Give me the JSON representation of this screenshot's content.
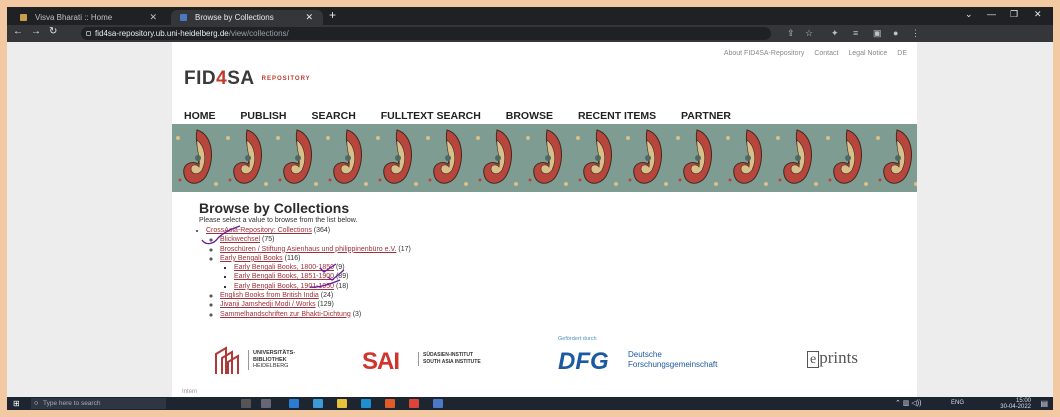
{
  "browser": {
    "tabs": [
      {
        "label": "Visva Bharati :: Home",
        "active": false
      },
      {
        "label": "Browse by Collections",
        "active": true
      }
    ],
    "url_host": "fid4sa-repository.ub.uni-heidelberg.de",
    "url_path": "/view/collections/"
  },
  "site": {
    "top_links": [
      "About FID4SA-Repository",
      "Contact",
      "Legal Notice",
      "DE"
    ],
    "logo_fid": "FID",
    "logo_4": "4",
    "logo_sa": "SA",
    "logo_repository": "REPOSITORY",
    "nav": [
      "HOME",
      "PUBLISH",
      "SEARCH",
      "FULLTEXT SEARCH",
      "BROWSE",
      "RECENT ITEMS",
      "PARTNER"
    ]
  },
  "content": {
    "heading": "Browse by Collections",
    "intro": "Please select a value to browse from the list below.",
    "root": {
      "label": "CrossAsia-Repository: Collections",
      "count": "(364)"
    },
    "items": [
      {
        "label": "Blickwechsel",
        "count": "(75)"
      },
      {
        "label": "Broschüren / Stiftung Asienhaus und philippinenbüro e.V.",
        "count": "(17)"
      },
      {
        "label": "Early Bengali Books",
        "count": "(116)"
      },
      {
        "label": "English Books from British India",
        "count": "(24)"
      },
      {
        "label": "Jivanji Jamshedji Modi / Works",
        "count": "(129)"
      },
      {
        "label": "Sammelhandschriften zur Bhakti-Dichtung",
        "count": "(3)"
      }
    ],
    "subitems": [
      {
        "label": "Early Bengali Books, 1800-1850",
        "count": "(9)"
      },
      {
        "label": "Early Bengali Books, 1851-1900",
        "count": "(89)"
      },
      {
        "label": "Early Bengali Books, 1901-1950",
        "count": "(18)"
      }
    ]
  },
  "footer": {
    "ub_line1": "UNIVERSITÄTS-",
    "ub_line2": "BIBLIOTHEK",
    "ub_line3": "HEIDELBERG",
    "sai_logo": "SAI",
    "sai_line1": "SÜDASIEN-INSTITUT",
    "sai_line2": "SOUTH ASIA INSTITUTE",
    "funded_by": "Gefördert durch",
    "dfg_logo": "DFG",
    "dfg_line1": "Deutsche",
    "dfg_line2": "Forschungsgemeinschaft",
    "eprints_e": "e",
    "eprints_rest": "prints",
    "intern": "Intern"
  },
  "taskbar": {
    "search_placeholder": "Type here to search",
    "lang": "ENG",
    "time": "15:00",
    "date": "30-04-2022"
  },
  "colors": {
    "link": "#a0303a",
    "annotation": "#6a1b9a",
    "banner_red": "#b8463c",
    "banner_teal": "#6d8f86"
  }
}
